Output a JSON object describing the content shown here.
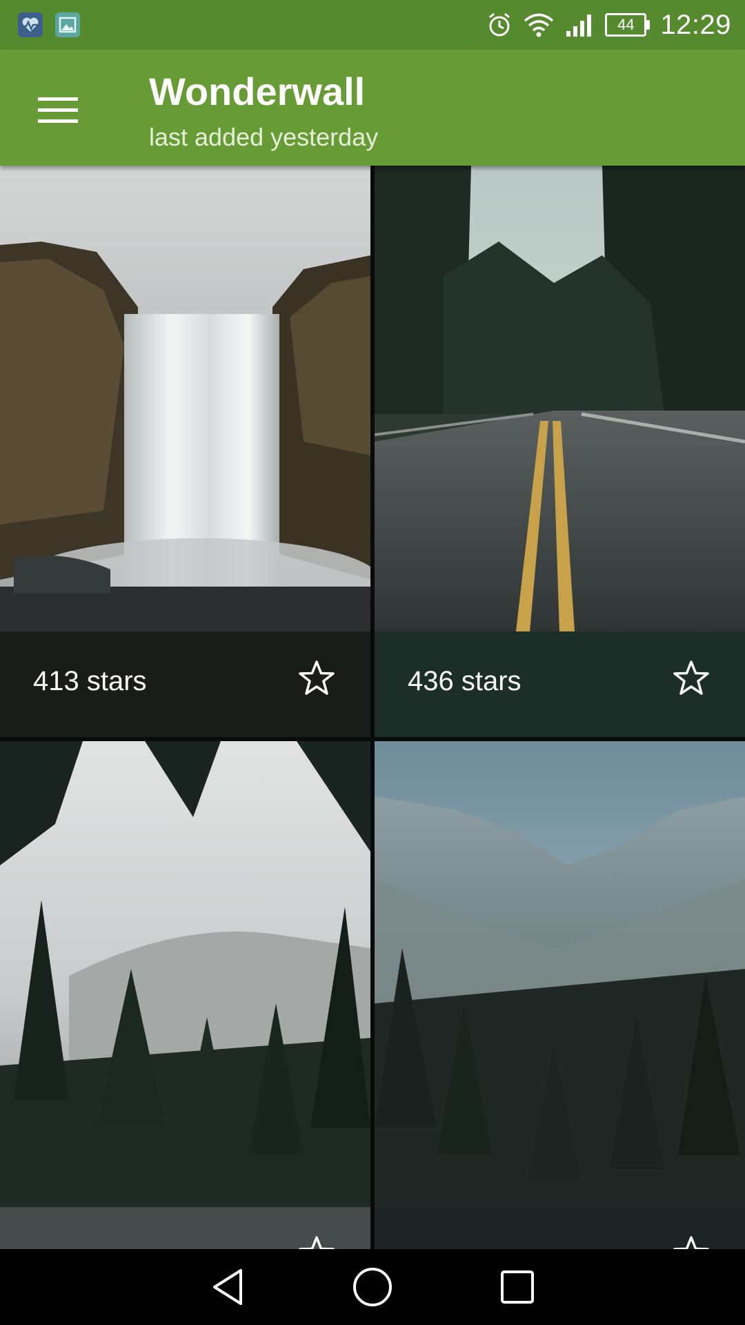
{
  "status_bar": {
    "time": "12:29",
    "battery": "44",
    "icons": [
      "health-app-icon",
      "gallery-app-icon",
      "alarm-icon",
      "wifi-icon",
      "signal-icon",
      "battery-icon"
    ]
  },
  "app_bar": {
    "title": "Wonderwall",
    "subtitle": "last added yesterday",
    "menu_icon": "hamburger-menu-icon"
  },
  "wallpapers": [
    {
      "stars_label": "413 stars",
      "scene": "waterfall",
      "footer_color": "#1a1c18"
    },
    {
      "stars_label": "436 stars",
      "scene": "wet-road-forest",
      "footer_color": "#1b2e28"
    },
    {
      "stars_label": "",
      "scene": "misty-pine-forest",
      "footer_color": "#454a4a"
    },
    {
      "stars_label": "",
      "scene": "snowy-mountain-valley",
      "footer_color": "#1d2423"
    }
  ],
  "nav_bar": {
    "icons": [
      "back-icon",
      "home-icon",
      "recents-icon"
    ]
  },
  "colors": {
    "status_bar": "#568a2f",
    "app_bar": "#679b35"
  }
}
